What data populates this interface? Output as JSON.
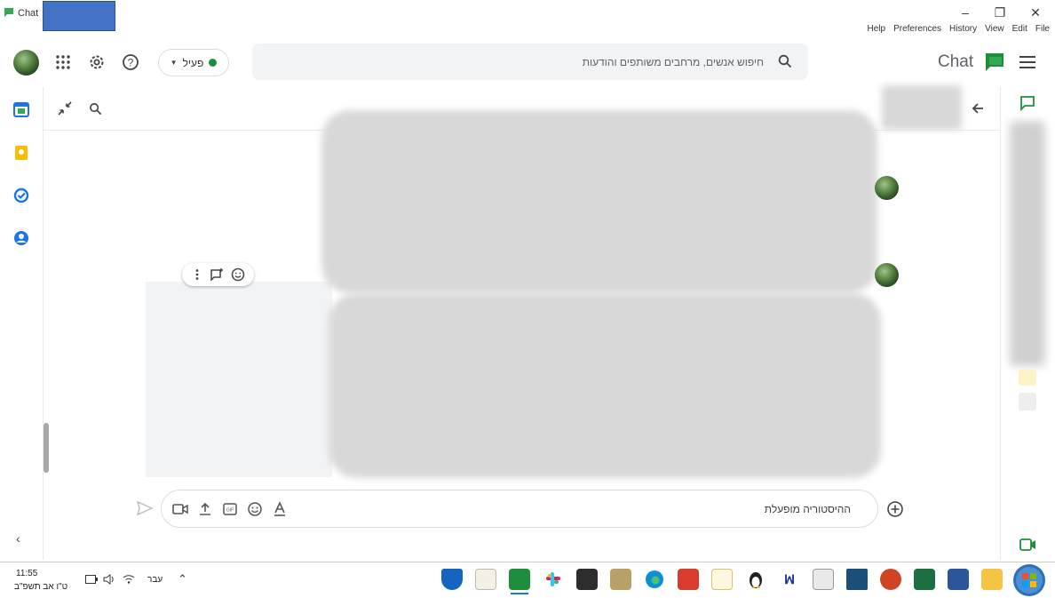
{
  "window": {
    "title": "Chat",
    "menus": [
      "Help",
      "Preferences",
      "History",
      "View",
      "Edit",
      "File"
    ],
    "minimize_glyph": "–",
    "restore_glyph": "❐",
    "close_glyph": "✕"
  },
  "header": {
    "status_label": "פעיל",
    "search_placeholder": "חיפוש אנשים, מרחבים משותפים והודעות",
    "brand": "Chat"
  },
  "compose": {
    "placeholder": "ההיסטוריה מופעלת"
  },
  "taskbar": {
    "time": "11:55",
    "date": "ט\"ו אב תשפ\"ב",
    "language": "עבר"
  },
  "colors": {
    "accent_green": "#1e8e3e",
    "chat_green": "#34a853",
    "active_blue": "#1a73e8",
    "redaction_blue": "#4472c4"
  }
}
